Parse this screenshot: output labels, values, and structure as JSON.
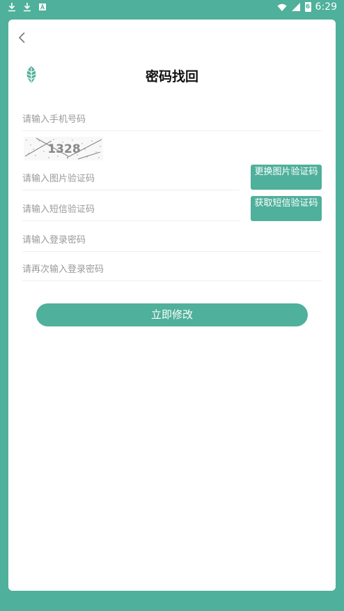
{
  "status_bar": {
    "time": "6:29",
    "battery": "6"
  },
  "page": {
    "title": "密码找回"
  },
  "form": {
    "phone_placeholder": "请输入手机号码",
    "captcha_text": "1328",
    "image_code_placeholder": "请输入图片验证码",
    "change_image_button": "更换图片验证码",
    "sms_code_placeholder": "请输入短信验证码",
    "get_sms_button": "获取短信验证码",
    "password_placeholder": "请输入登录密码",
    "confirm_password_placeholder": "请再次输入登录密码",
    "submit_button": "立即修改"
  },
  "colors": {
    "accent": "#4fb09b",
    "card": "#ffffff",
    "placeholder": "#9a9a9a"
  },
  "icons": {
    "back": "chevron-left-icon",
    "logo": "leaf-logo-icon",
    "download": "download-icon",
    "app": "a-app-icon",
    "wifi": "wifi-icon",
    "signal": "signal-icon",
    "battery": "battery-icon"
  }
}
